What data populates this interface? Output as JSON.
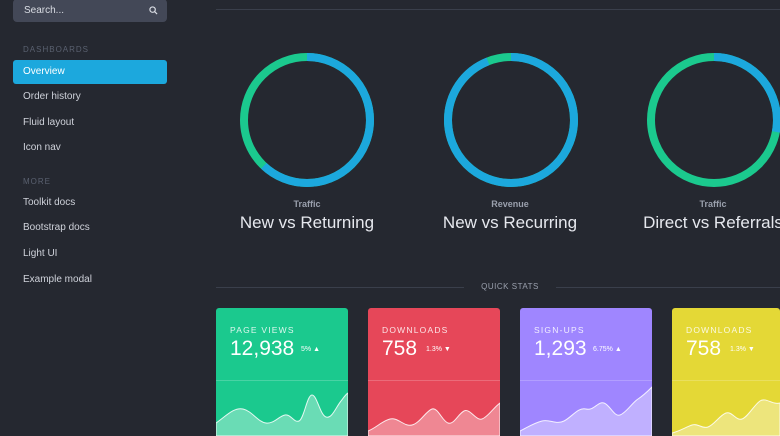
{
  "sidebar": {
    "search": {
      "placeholder": "Search..."
    },
    "sections": [
      {
        "header": "DASHBOARDS",
        "items": [
          "Overview",
          "Order history",
          "Fluid layout",
          "Icon nav"
        ]
      },
      {
        "header": "MORE",
        "items": [
          "Toolkit docs",
          "Bootstrap docs",
          "Light UI",
          "Example modal"
        ]
      }
    ],
    "active_item": "Overview"
  },
  "donuts": [
    {
      "label": "Traffic",
      "title": "New vs Returning",
      "primary_share": 0.62,
      "primary_color": "#1ca8dd",
      "secondary_color": "#1bc98e"
    },
    {
      "label": "Revenue",
      "title": "New vs Recurring",
      "primary_share": 0.94,
      "primary_color": "#1ca8dd",
      "secondary_color": "#1bc98e"
    },
    {
      "label": "Traffic",
      "title": "Direct vs Referrals",
      "primary_share": 0.28,
      "primary_color": "#1ca8dd",
      "secondary_color": "#1bc98e"
    }
  ],
  "quick_stats": {
    "label": "QUICK STATS",
    "cards": [
      {
        "label": "PAGE VIEWS",
        "value": "12,938",
        "delta": "5%",
        "trend": "up",
        "color": "#1bc98e"
      },
      {
        "label": "DOWNLOADS",
        "value": "758",
        "delta": "1.3%",
        "trend": "down",
        "color": "#e64759"
      },
      {
        "label": "SIGN-UPS",
        "value": "1,293",
        "delta": "6.75%",
        "trend": "up",
        "color": "#9f86ff"
      },
      {
        "label": "DOWNLOADS",
        "value": "758",
        "delta": "1.3%",
        "trend": "down",
        "color": "#e4d836"
      }
    ]
  },
  "icons": {
    "search": "search-icon",
    "trend_up": "caret-up-icon",
    "trend_down": "caret-down-icon"
  }
}
